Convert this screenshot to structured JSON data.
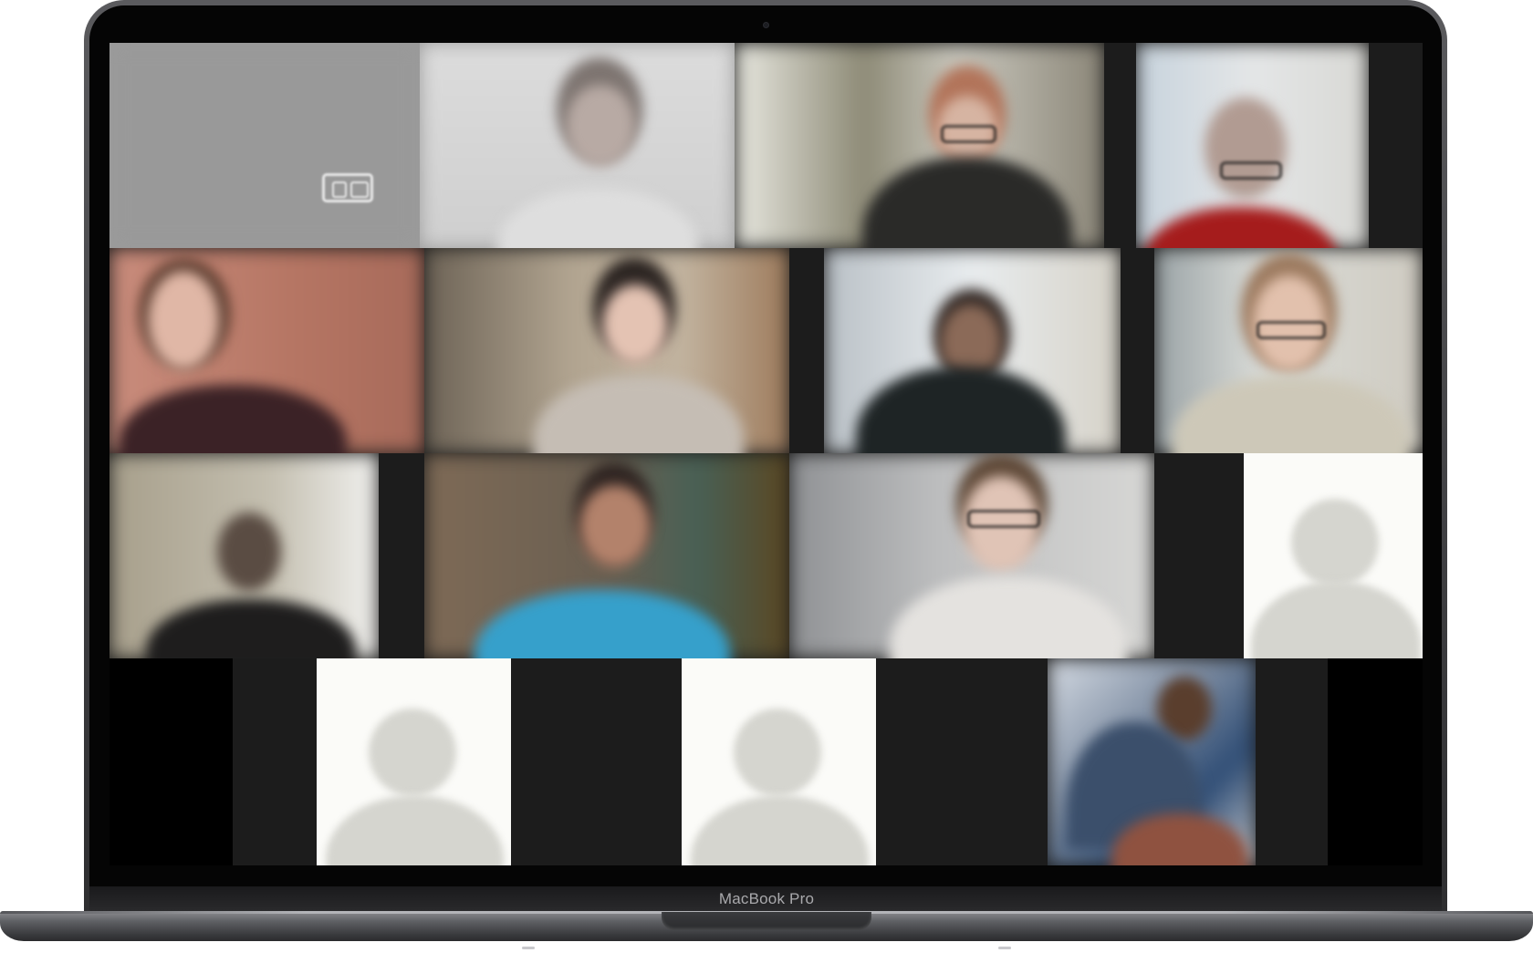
{
  "device": {
    "model_label": "MacBook Pro"
  },
  "meeting": {
    "view": "gallery",
    "participant_tiles": [
      {
        "kind": "video",
        "camera_off_indicator": true
      },
      {
        "kind": "video"
      },
      {
        "kind": "video"
      },
      {
        "kind": "video"
      },
      {
        "kind": "video"
      },
      {
        "kind": "video"
      },
      {
        "kind": "video"
      },
      {
        "kind": "video"
      },
      {
        "kind": "video"
      },
      {
        "kind": "video"
      },
      {
        "kind": "avatar"
      },
      {
        "kind": "avatar"
      },
      {
        "kind": "avatar"
      },
      {
        "kind": "video"
      }
    ],
    "icons": {
      "camera_off": "camera-off-icon",
      "default_avatar": "user-silhouette-icon"
    },
    "colors": {
      "grid_background": "#000000",
      "tile_gap": "#1c1c1c",
      "avatar_background": "#fbfbf8",
      "avatar_silhouette": "#d5d5cf"
    }
  }
}
